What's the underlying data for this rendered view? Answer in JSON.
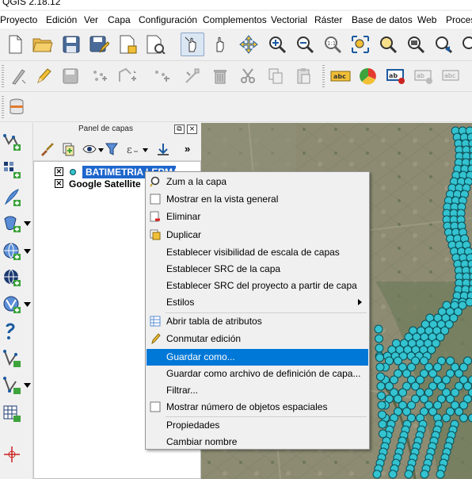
{
  "window": {
    "title": "QGIS 2.18.12"
  },
  "menubar": {
    "items": [
      "Proyecto",
      "Edición",
      "Ver",
      "Capa",
      "Configuración",
      "Complementos",
      "Vectorial",
      "Ráster",
      "Base de datos",
      "Web",
      "Proces"
    ]
  },
  "layers_panel": {
    "title": "Panel de capas",
    "float_glyph": "⧉",
    "close_glyph": "×",
    "more_glyph": "»",
    "layers": [
      {
        "name": "BATIMETRIA LERMA",
        "checked_mark": "×",
        "selected": true
      },
      {
        "name": "Google Satellite",
        "checked_mark": "×",
        "selected": false
      }
    ]
  },
  "context_menu": {
    "items": [
      {
        "label": "Zum a la capa",
        "icon": "zoom-layer-icon"
      },
      {
        "label": "Mostrar en la vista general",
        "icon": "checkbox-icon"
      },
      {
        "label": "Eliminar",
        "icon": "remove-layer-icon"
      },
      {
        "label": "Duplicar",
        "icon": "duplicate-layer-icon"
      },
      {
        "label": "Establecer visibilidad de escala de capas",
        "icon": ""
      },
      {
        "label": "Establecer SRC de la capa",
        "icon": ""
      },
      {
        "label": "Establecer SRC del proyecto a partir de capa",
        "icon": ""
      },
      {
        "label": "Estilos",
        "icon": "",
        "submenu": true
      },
      {
        "label": "Abrir tabla de atributos",
        "icon": "attribute-table-icon"
      },
      {
        "label": "Conmutar edición",
        "icon": "pencil-icon"
      },
      {
        "label": "Guardar como...",
        "icon": "",
        "highlighted": true
      },
      {
        "label": "Guardar como archivo de definición de capa...",
        "icon": ""
      },
      {
        "label": "Filtrar...",
        "icon": ""
      },
      {
        "label": "Mostrar número de objetos espaciales",
        "icon": "checkbox-icon"
      },
      {
        "label": "Propiedades",
        "icon": ""
      },
      {
        "label": "Cambiar nombre",
        "icon": ""
      }
    ]
  },
  "colors": {
    "highlight": "#0078d7",
    "selected_layer_bg": "#1e66cc",
    "points": "#34c3d0",
    "points_outline": "#0a4e58",
    "map_bg": "#8a8b72"
  }
}
